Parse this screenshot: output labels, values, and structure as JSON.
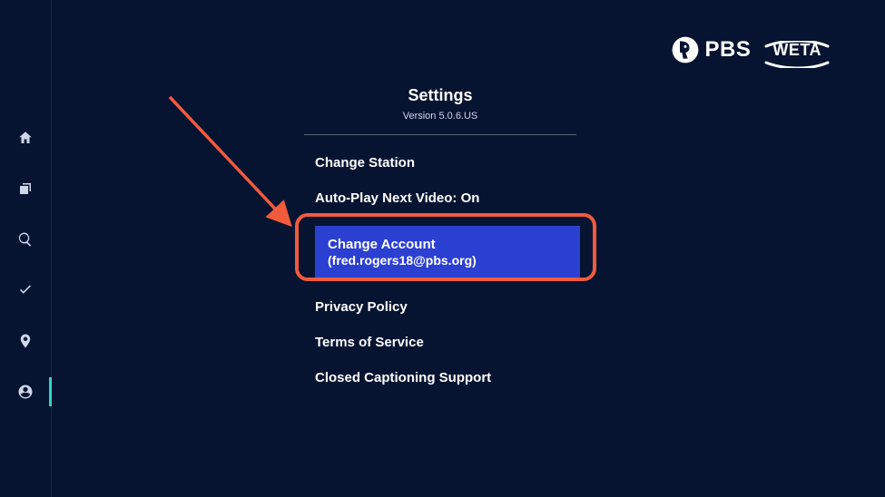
{
  "header": {
    "pbs_label": "PBS",
    "station_label": "WETA"
  },
  "settings": {
    "title": "Settings",
    "version": "Version 5.0.6.US"
  },
  "menu": {
    "change_station": "Change Station",
    "autoplay": "Auto-Play Next Video: On",
    "change_account_line1": "Change Account",
    "change_account_line2": "(fred.rogers18@pbs.org)",
    "privacy": "Privacy Policy",
    "terms": "Terms of Service",
    "captioning": "Closed Captioning Support"
  }
}
